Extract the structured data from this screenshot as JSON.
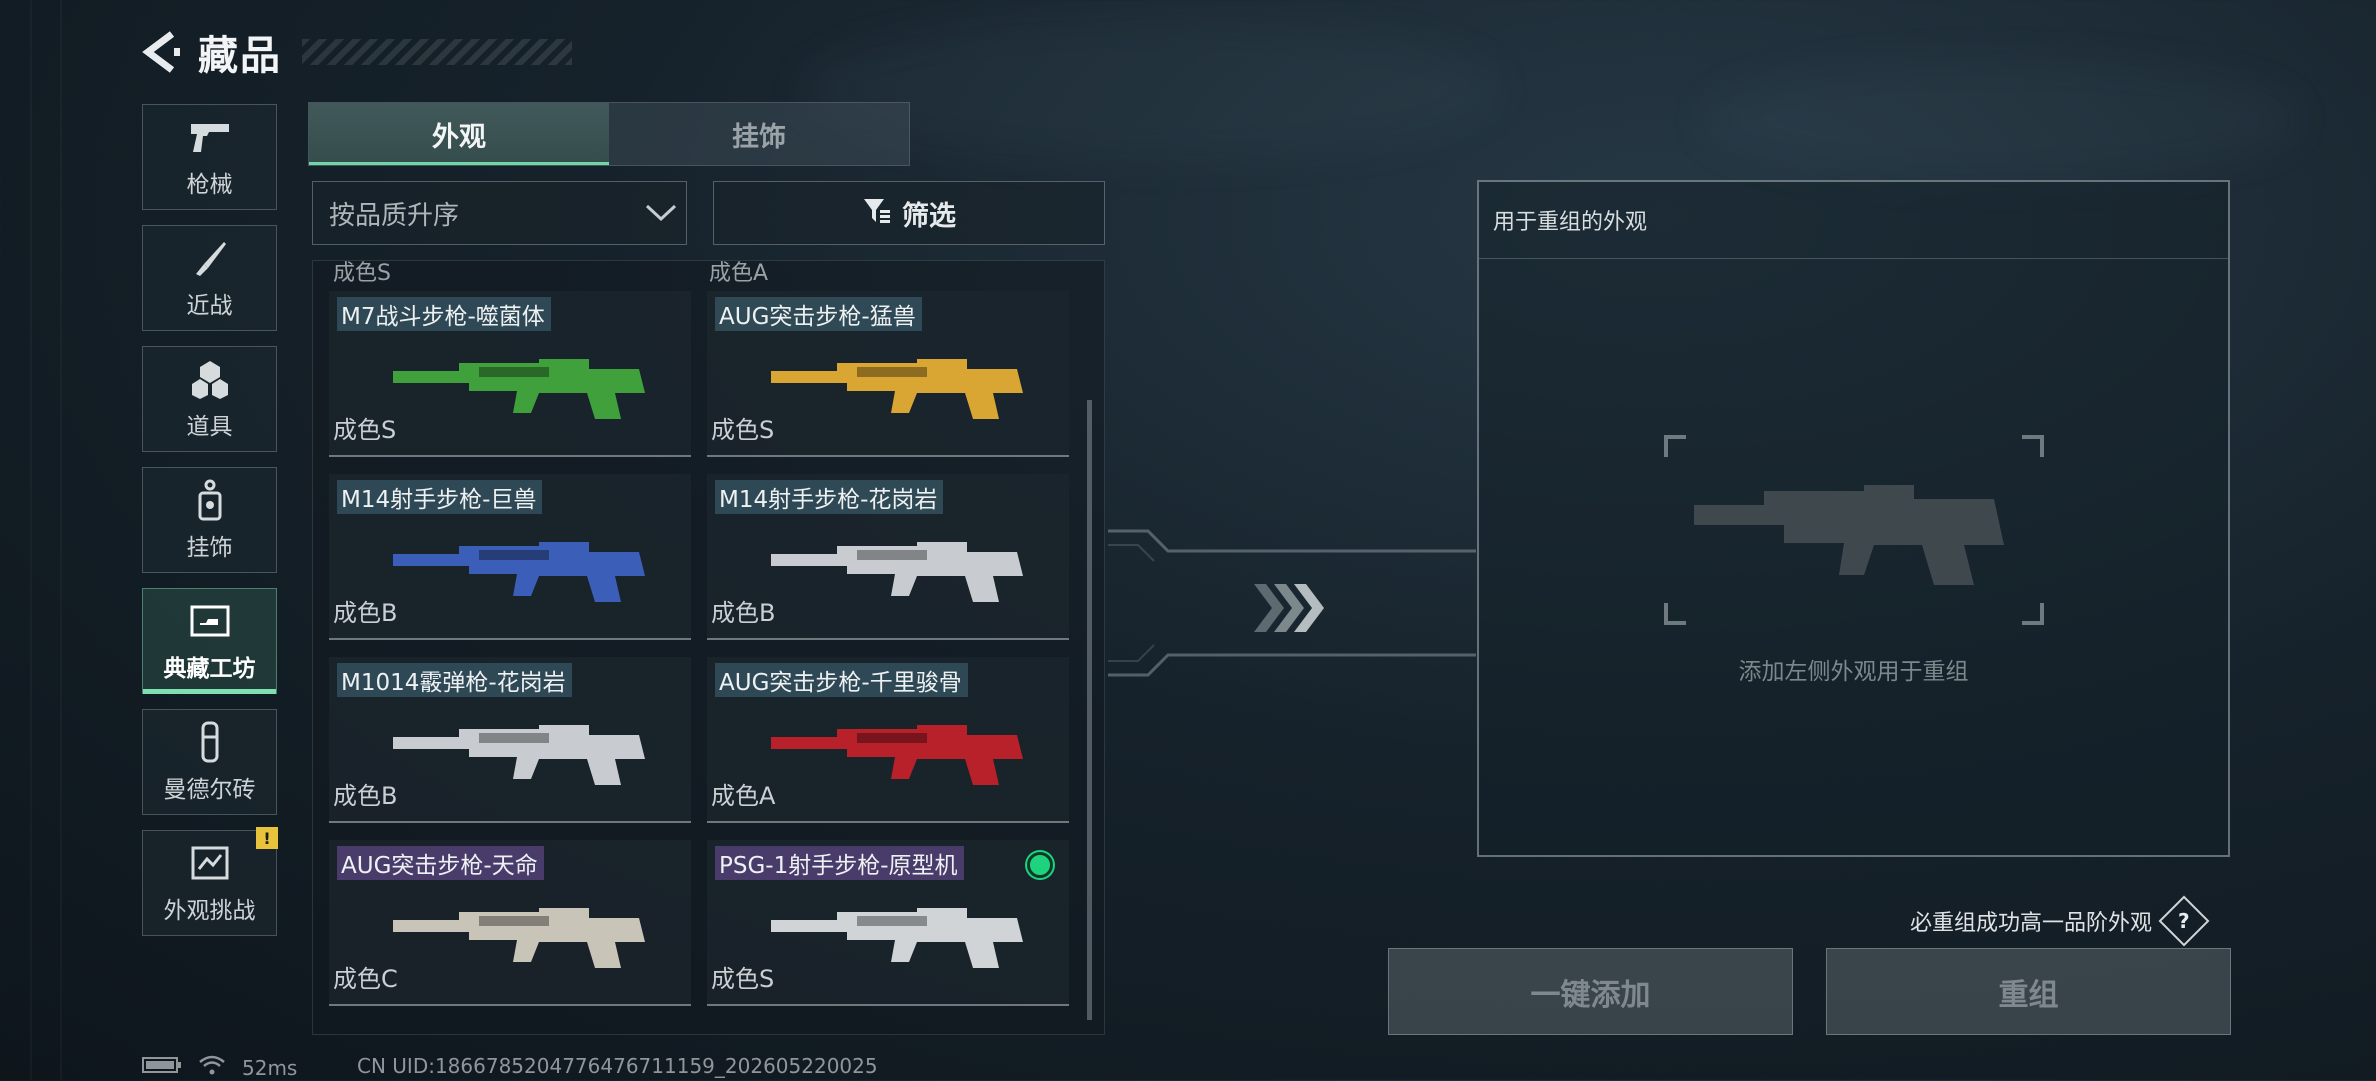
{
  "header": {
    "title": "藏品"
  },
  "sidebar": {
    "items": [
      {
        "label": "枪械",
        "icon": "pistol-icon"
      },
      {
        "label": "近战",
        "icon": "knife-icon"
      },
      {
        "label": "道具",
        "icon": "grenade-icon"
      },
      {
        "label": "挂饰",
        "icon": "charm-icon"
      },
      {
        "label": "典藏工坊",
        "icon": "workshop-icon",
        "active": true
      },
      {
        "label": "曼德尔砖",
        "icon": "brick-icon"
      },
      {
        "label": "外观挑战",
        "icon": "challenge-icon",
        "badge": "!"
      }
    ]
  },
  "tabs": [
    {
      "label": "外观",
      "active": true
    },
    {
      "label": "挂饰"
    }
  ],
  "sort": {
    "selected": "按品质升序"
  },
  "filter": {
    "label": "筛选"
  },
  "partial_row": {
    "left": "成色S",
    "right": "成色A"
  },
  "cards": [
    {
      "name": "M7战斗步枪-噬菌体",
      "grade": "成色S",
      "gun_color": "#3fa03c",
      "name_style": "blue"
    },
    {
      "name": "AUG突击步枪-猛兽",
      "grade": "成色S",
      "gun_color": "#d9a533",
      "name_style": "blue"
    },
    {
      "name": "M14射手步枪-巨兽",
      "grade": "成色B",
      "gun_color": "#3b5fb8",
      "name_style": "blue"
    },
    {
      "name": "M14射手步枪-花岗岩",
      "grade": "成色B",
      "gun_color": "#c8ccd0",
      "name_style": "blue"
    },
    {
      "name": "M1014霰弹枪-花岗岩",
      "grade": "成色B",
      "gun_color": "#c8ccd0",
      "name_style": "blue"
    },
    {
      "name": "AUG突击步枪-千里骏骨",
      "grade": "成色A",
      "gun_color": "#b8202a",
      "name_style": "blue"
    },
    {
      "name": "AUG突击步枪-天命",
      "grade": "成色C",
      "gun_color": "#c9c4b8",
      "name_style": "purple"
    },
    {
      "name": "PSG-1射手步枪-原型机",
      "grade": "成色S",
      "gun_color": "#d0d4d6",
      "name_style": "purple",
      "equipped": true
    }
  ],
  "recombine": {
    "title": "用于重组的外观",
    "hint": "添加左侧外观用于重组"
  },
  "note": {
    "text": "必重组成功高一品阶外观",
    "help": "?"
  },
  "buttons": {
    "add_all": "一键添加",
    "recombine": "重组"
  },
  "status": {
    "ping": "52ms",
    "uid": "CN UID:1866785204776476711159_202605220025"
  }
}
